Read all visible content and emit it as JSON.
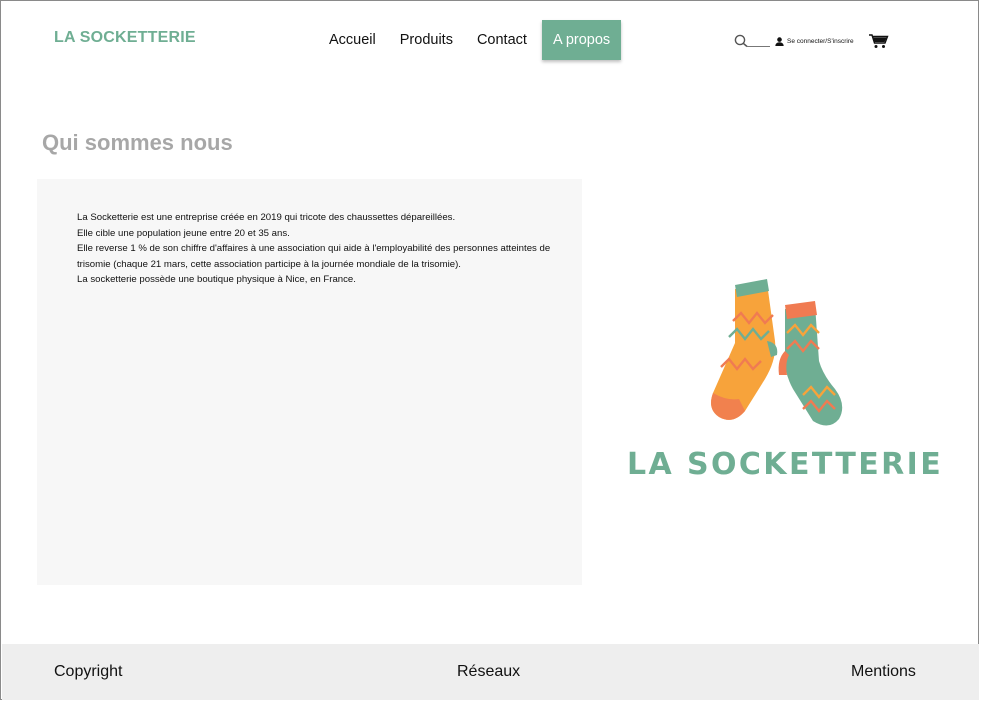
{
  "header": {
    "logo": "LA SOCKETTERIE",
    "nav": [
      "Accueil",
      "Produits",
      "Contact",
      "A propos"
    ],
    "active_nav": "A propos",
    "login_label": "Se connecter/S'inscrire",
    "icons": [
      "search-icon",
      "user-icon",
      "cart-icon"
    ]
  },
  "main": {
    "title": "Qui sommes nous",
    "about_lines": [
      "La Socketterie est une entreprise créée en 2019 qui tricote des chaussettes dépareillées.",
      "Elle cible une population jeune entre 20 et 35 ans.",
      "Elle reverse 1 % de son chiffre d'affaires à une association qui aide à l'employabilité des personnes atteintes de trisomie (chaque 21 mars, cette association participe à la journée mondiale de la trisomie).",
      "La socketterie possède une boutique physique à Nice, en France."
    ],
    "brand_logo_text": "LA SOCKETTERIE"
  },
  "footer": {
    "copyright": "Copyright",
    "networks": "Réseaux",
    "mentions": "Mentions"
  },
  "colors": {
    "accent": "#6fae93",
    "sock_orange": "#f7a33b",
    "sock_coral": "#f07b52",
    "title_grey": "#a7a7a7",
    "box_bg": "#f7f7f7",
    "footer_bg": "#eeeeee"
  }
}
